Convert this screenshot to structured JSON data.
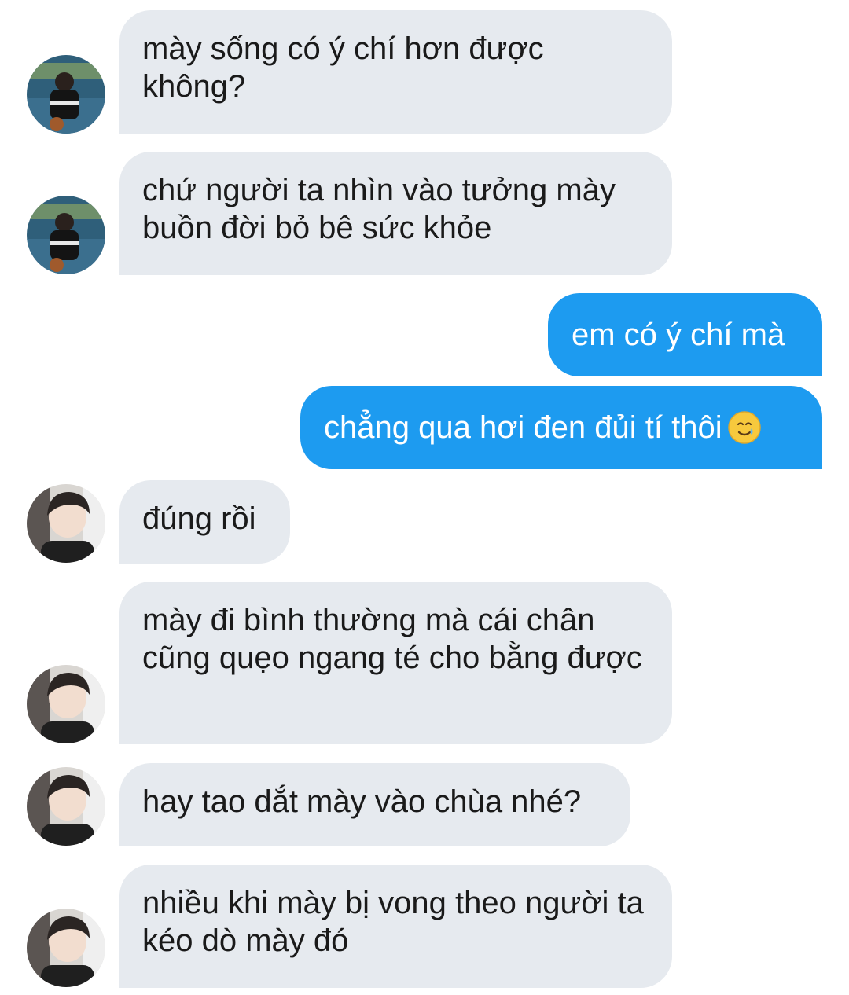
{
  "messages": [
    {
      "direction": "incoming",
      "text": "mày sống có ý chí hơn được không?",
      "avatar": "avatar-photo-1-icon"
    },
    {
      "direction": "incoming",
      "text": "chứ người ta nhìn vào tưởng mày buồn đời bỏ bê sức khỏe",
      "avatar": "avatar-photo-1-icon"
    },
    {
      "direction": "outgoing",
      "text": "em có ý chí mà"
    },
    {
      "direction": "outgoing",
      "text": "chẳng qua hơi đen đủi tí thôi",
      "emoji": "smiling-face-with-tear-icon"
    },
    {
      "direction": "incoming",
      "text": "đúng rồi",
      "avatar": "avatar-photo-2-icon"
    },
    {
      "direction": "incoming",
      "text": "mày đi bình thường mà cái chân cũng quẹo ngang té cho bằng được",
      "avatar": "avatar-photo-2-icon"
    },
    {
      "direction": "incoming",
      "text": "hay tao dắt mày vào chùa nhé?",
      "avatar": "avatar-photo-2-icon"
    },
    {
      "direction": "incoming",
      "text": "nhiều khi mày bị vong theo người ta kéo dò mày đó",
      "avatar": "avatar-photo-2-icon"
    }
  ],
  "colors": {
    "incoming_bubble": "#e6eaef",
    "outgoing_bubble": "#1d9bf0",
    "incoming_text": "#1a1a1a",
    "outgoing_text": "#ffffff"
  }
}
